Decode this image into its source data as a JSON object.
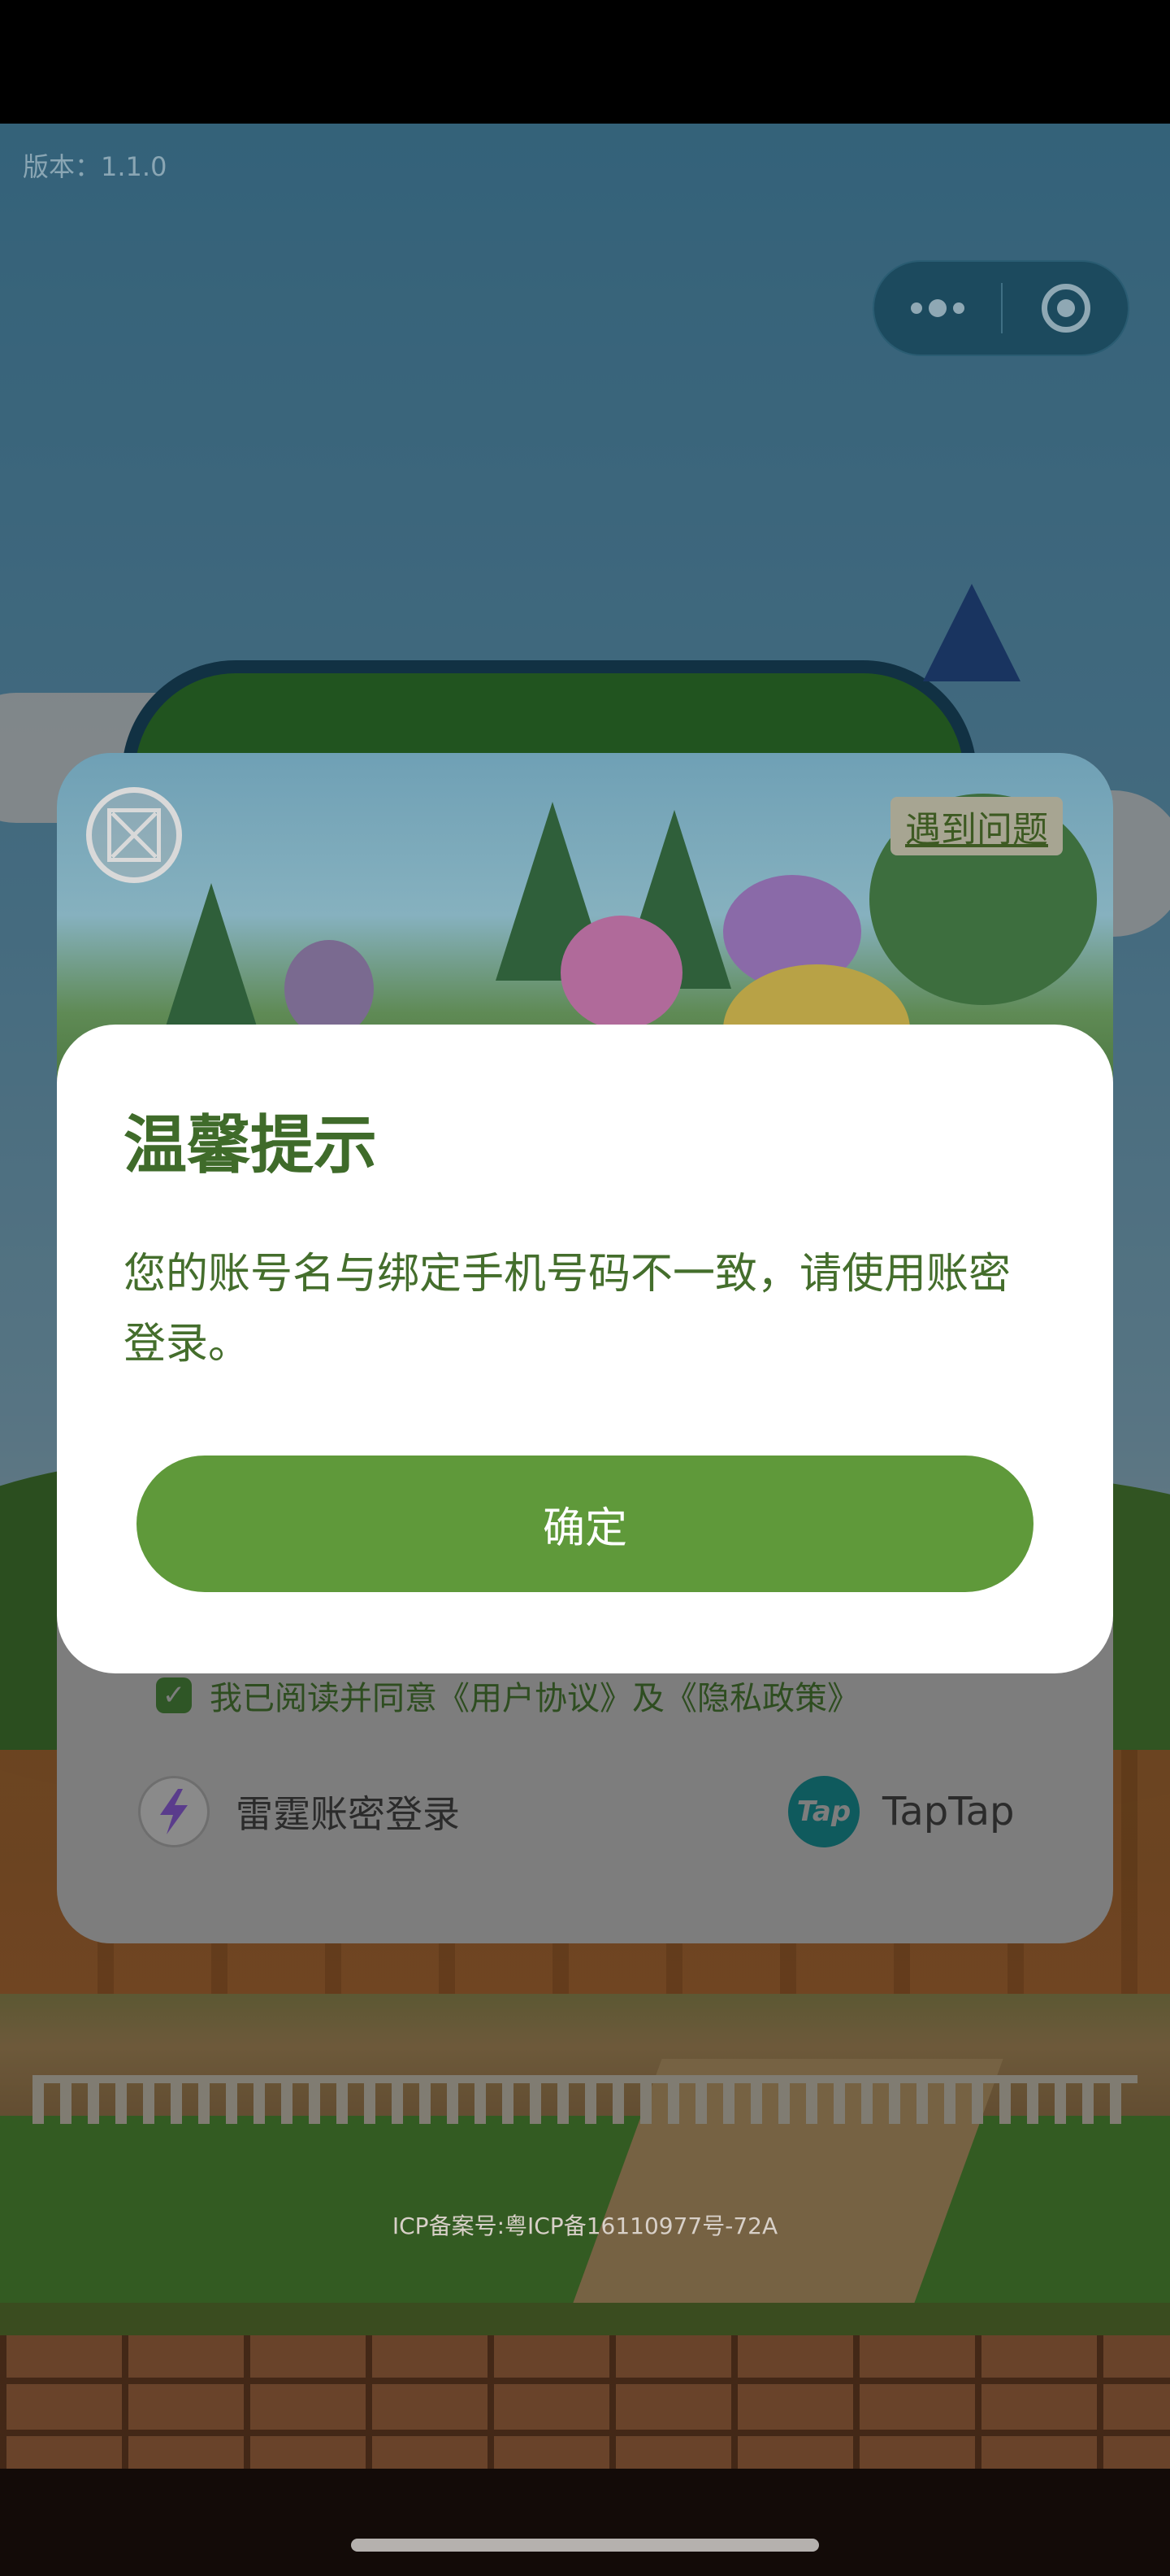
{
  "app": {
    "version_text": "版本：1.1.0",
    "icp_text": "ICP备案号:粤ICP备16110977号-72A"
  },
  "capsule": {
    "more_icon": "more-dots-icon",
    "close_icon": "target-close-icon"
  },
  "login_panel": {
    "close_icon": "close-square-icon",
    "problem_label": "遇到问题",
    "agree_text": "我已阅读并同意《用户协议》及《隐私政策》",
    "leiting_login_label": "雷霆账密登录",
    "leiting_icon": "leiting-lightning-icon",
    "taptap_label": "TapTap",
    "taptap_icon_text": "Tap"
  },
  "dialog": {
    "title": "温馨提示",
    "message": "您的账号名与绑定手机号码不一致，请使用账密登录。",
    "confirm_label": "确定"
  },
  "colors": {
    "accent_green": "#5f993a",
    "title_green": "#3f6b2a",
    "dialog_bg": "#ffffff"
  }
}
